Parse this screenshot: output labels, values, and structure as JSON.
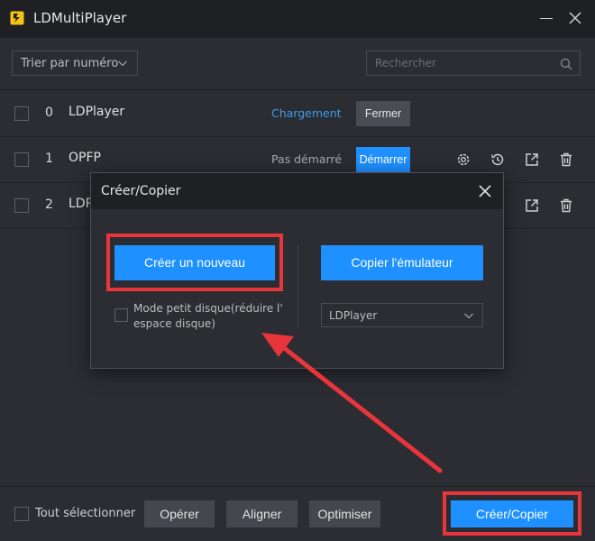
{
  "window": {
    "title": "LDMultiPlayer"
  },
  "toolbar": {
    "sort_label": "Trier par numéro",
    "search_placeholder": "Rechercher"
  },
  "instances": [
    {
      "index": "0",
      "name": "LDPlayer",
      "status": "Chargement",
      "action": "Fermer"
    },
    {
      "index": "1",
      "name": "OPFP",
      "status": "Pas démarré",
      "action": "Démarrer"
    },
    {
      "index": "2",
      "name": "LDP"
    }
  ],
  "modal": {
    "title": "Créer/Copier",
    "create_new": "Créer un nouveau",
    "copy_emulator": "Copier l'émulateur",
    "small_disk_line1": "Mode petit disque(réduire l'",
    "small_disk_line2": "espace disque)",
    "copy_source": "LDPlayer"
  },
  "bottom": {
    "select_all": "Tout sélectionner",
    "operate": "Opérer",
    "align": "Aligner",
    "optimize": "Optimiser",
    "create_copy": "Créer/Copier"
  },
  "colors": {
    "accent": "#1e90ff",
    "highlight": "#e8353b",
    "status_loading": "#3d9ee8"
  }
}
